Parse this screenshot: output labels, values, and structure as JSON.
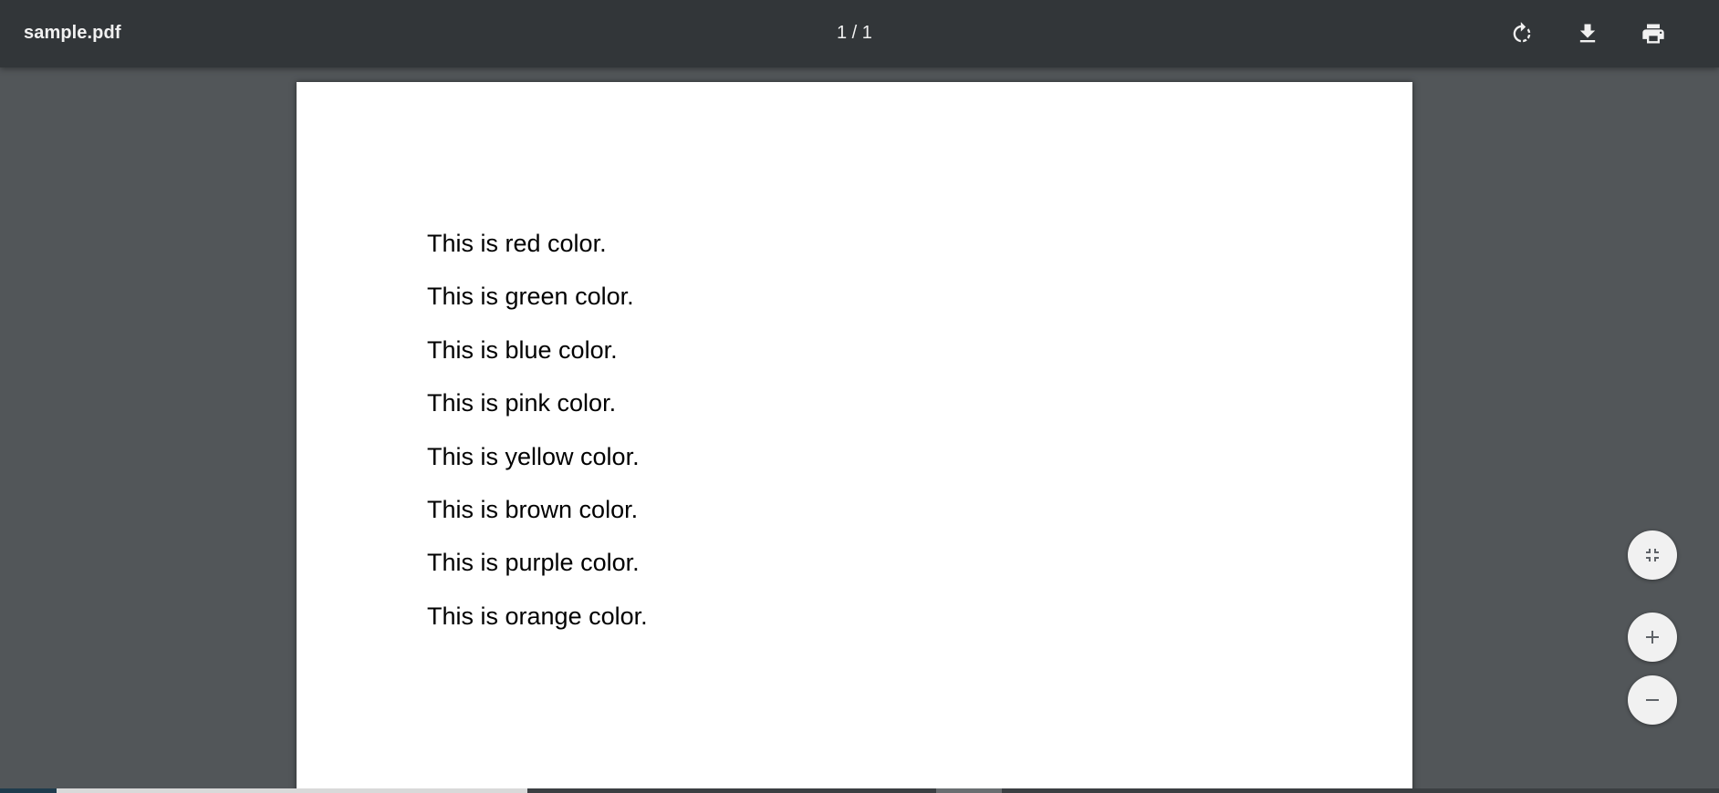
{
  "toolbar": {
    "title": "sample.pdf",
    "page_indicator": "1 / 1",
    "rotate_icon": "rotate-icon",
    "download_icon": "download-icon",
    "print_icon": "print-icon"
  },
  "document": {
    "lines": [
      "This is red color.",
      "This is green color.",
      "This is blue color.",
      "This is pink color.",
      "This is yellow color.",
      "This is brown color.",
      "This is purple color.",
      "This is orange color."
    ]
  },
  "zoom_controls": {
    "fit_icon": "fit-to-page-icon",
    "zoom_in_icon": "zoom-in-icon",
    "zoom_out_icon": "zoom-out-icon"
  },
  "colors": {
    "toolbar_bg": "#323639",
    "viewer_bg": "#525659",
    "page_bg": "#ffffff",
    "text": "#000000"
  }
}
